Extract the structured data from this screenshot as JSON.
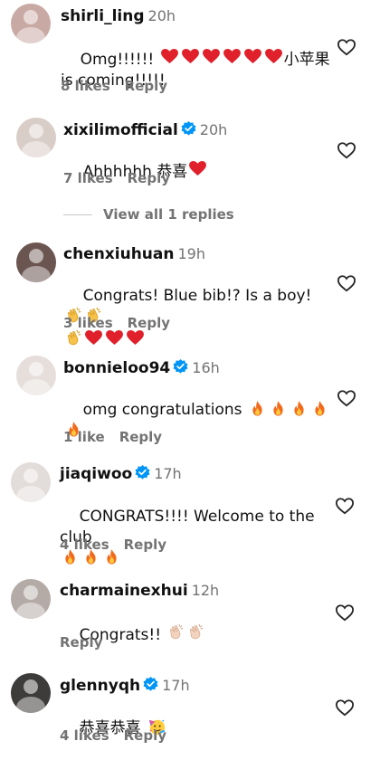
{
  "colors": {
    "text": "#111111",
    "muted": "#737373",
    "red_heart": "#e0202a",
    "verified": "#0095f6",
    "fire": "#f26b1d"
  },
  "comments": [
    {
      "user": "shirli_ling",
      "time": "20h",
      "verified": false,
      "text_a": "Omg!!!!!! ",
      "text_b": "小苹果",
      "text_c": "is coming!!!!!",
      "likes": "8 likes",
      "reply": "Reply"
    },
    {
      "user": "xixilimofficial",
      "time": "20h",
      "verified": true,
      "text": "Ahhhhhh 恭喜",
      "likes": "7 likes",
      "reply": "Reply"
    },
    {
      "user": "chenxiuhuan",
      "time": "19h",
      "verified": false,
      "text": "Congrats! Blue bib!? Is a boy!",
      "likes": "3 likes",
      "reply": "Reply"
    },
    {
      "user": "bonnieloo94",
      "time": "16h",
      "verified": true,
      "text": "omg congratulations",
      "likes": "1 like",
      "reply": "Reply"
    },
    {
      "user": "jiaqiwoo",
      "time": "17h",
      "verified": true,
      "text": "CONGRATS!!!! Welcome to the club",
      "likes": "4 likes",
      "reply": "Reply"
    },
    {
      "user": "charmainexhui",
      "time": "12h",
      "verified": false,
      "text": "Congrats!!",
      "reply": "Reply"
    },
    {
      "user": "glennyqh",
      "time": "17h",
      "verified": true,
      "text": "恭喜恭喜",
      "likes": "4 likes",
      "reply": "Reply"
    }
  ],
  "view_replies": "View all 1 replies",
  "icons": {
    "like": "heart-outline-icon",
    "verified": "verified-badge-icon",
    "red_heart": "red-heart-emoji",
    "fire": "fire-emoji",
    "clap": "clapping-hands-emoji",
    "party": "partying-face-emoji"
  }
}
